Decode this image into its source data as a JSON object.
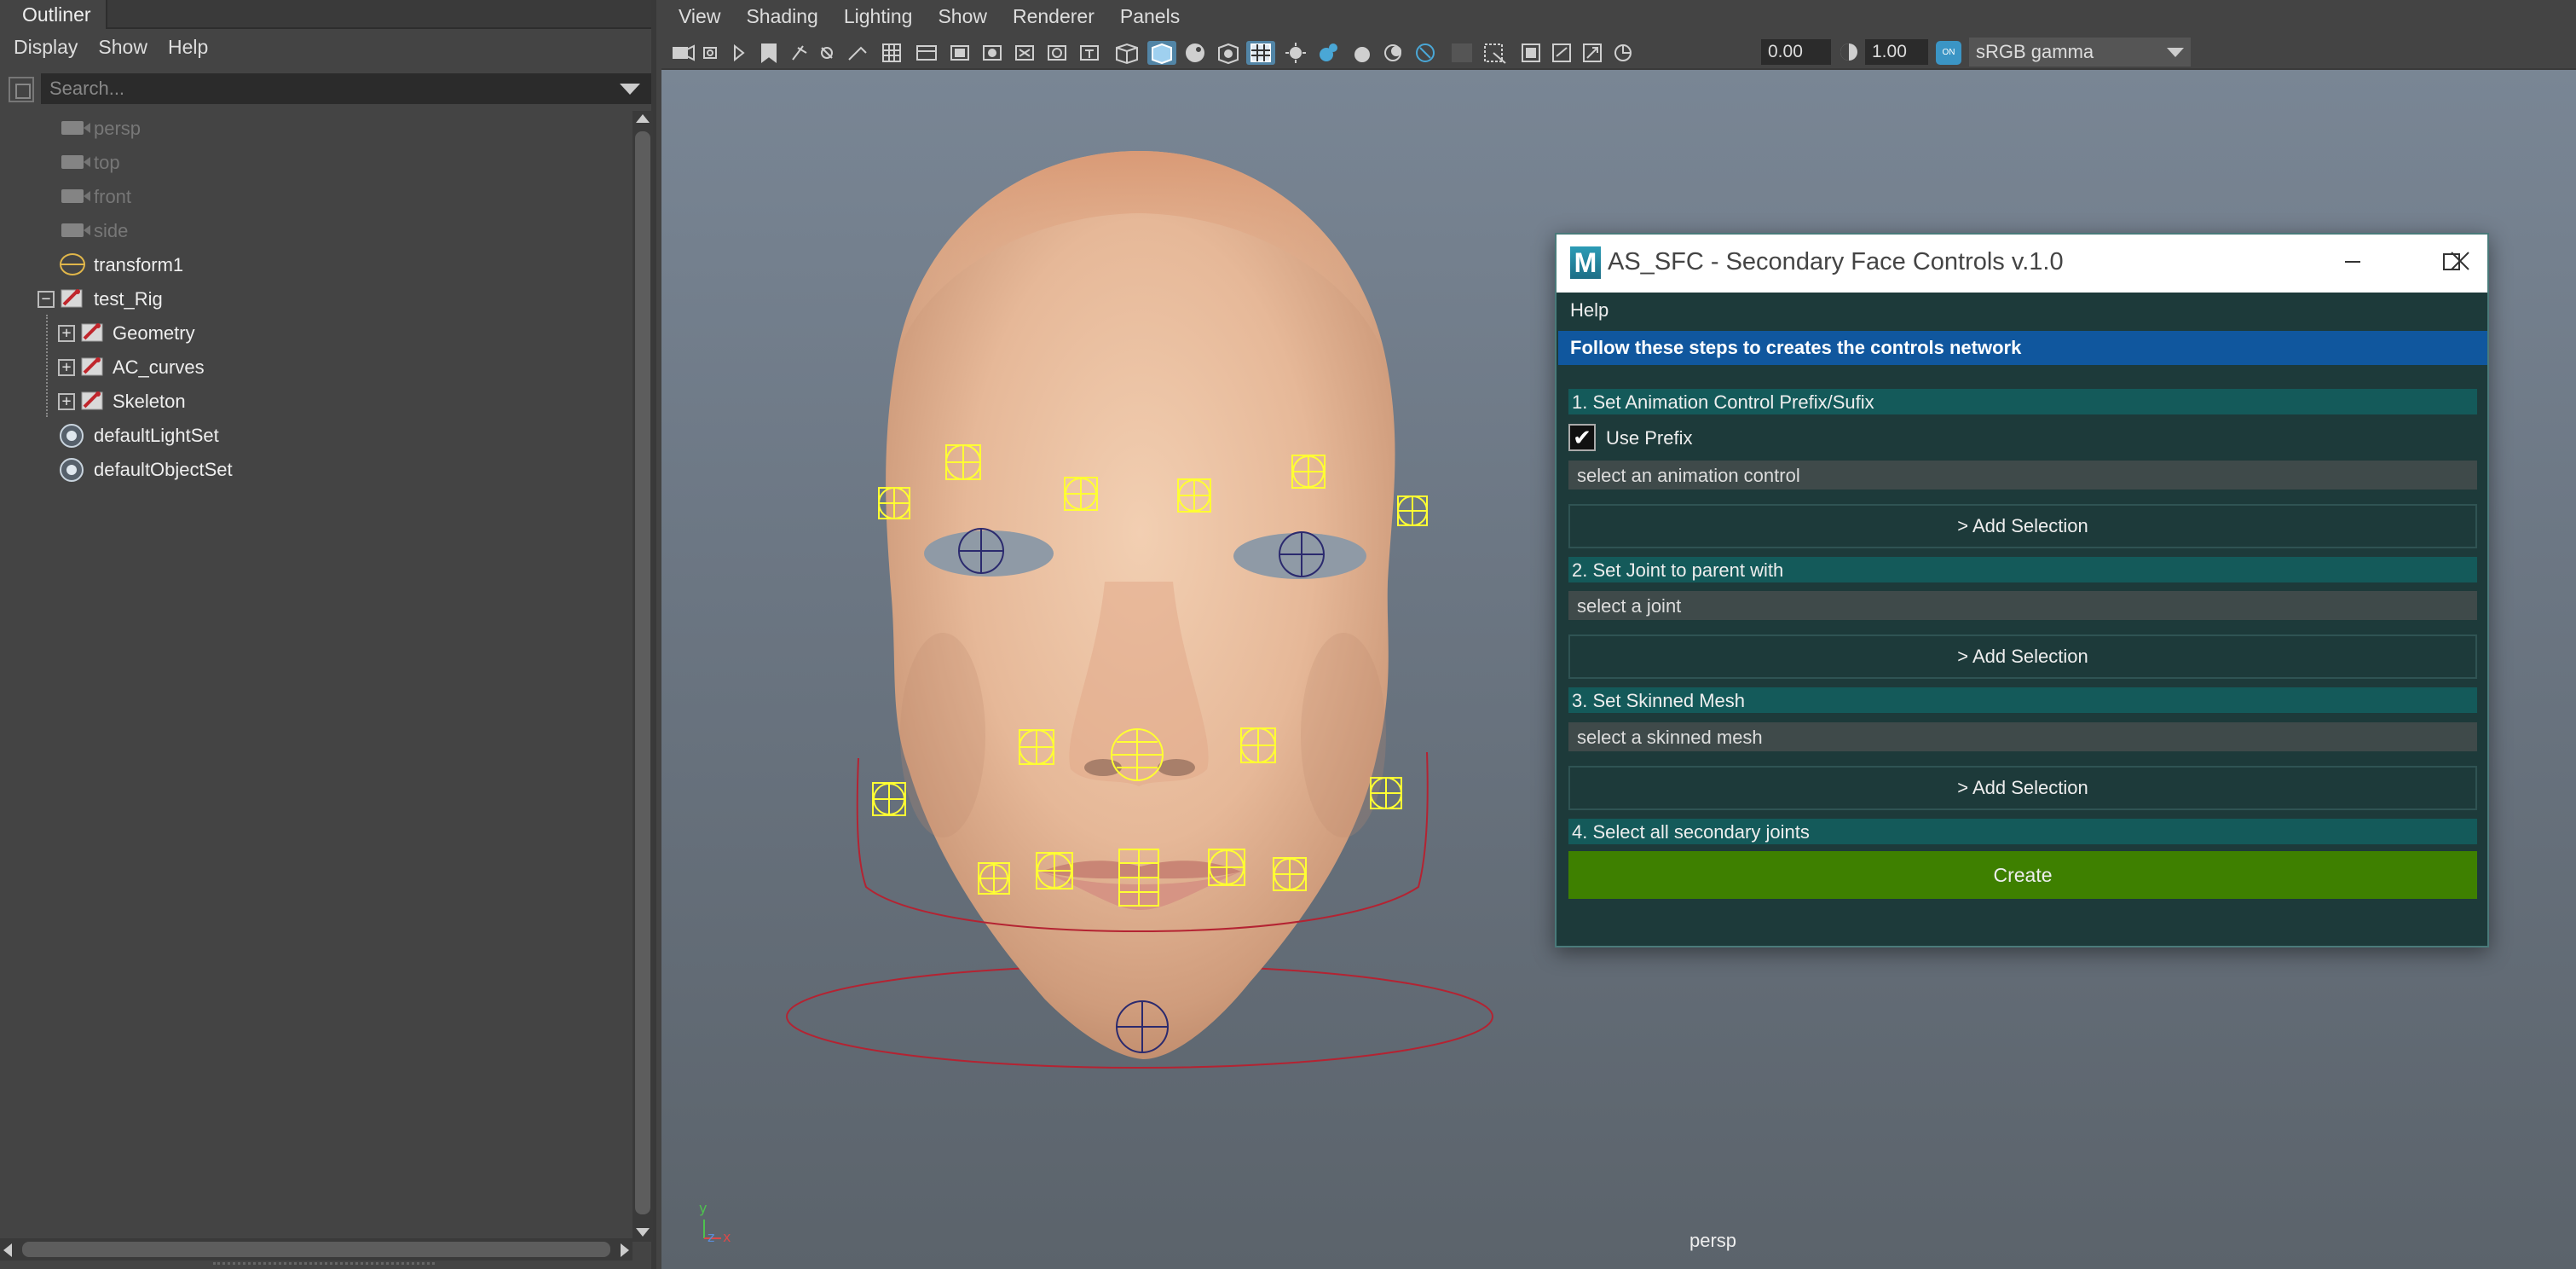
{
  "outliner": {
    "tab_title": "Outliner",
    "menu": [
      "Display",
      "Show",
      "Help"
    ],
    "search_placeholder": "Search...",
    "items": [
      {
        "label": "persp"
      },
      {
        "label": "top"
      },
      {
        "label": "front"
      },
      {
        "label": "side"
      },
      {
        "label": "transform1"
      },
      {
        "label": "test_Rig"
      },
      {
        "label": "Geometry"
      },
      {
        "label": "AC_curves"
      },
      {
        "label": "Skeleton"
      },
      {
        "label": "defaultLightSet"
      },
      {
        "label": "defaultObjectSet"
      }
    ]
  },
  "viewport": {
    "menu": [
      "View",
      "Shading",
      "Lighting",
      "Show",
      "Renderer",
      "Panels"
    ],
    "exposure_value": "0.00",
    "gamma_value": "1.00",
    "color_space": "sRGB gamma",
    "camera_label": "persp",
    "axis": {
      "y": "y",
      "z": "z",
      "x": "x"
    }
  },
  "dialog": {
    "title": "AS_SFC - Secondary Face Controls v.1.0",
    "menu_help": "Help",
    "banner": "Follow these steps to creates the controls network",
    "step1": "1. Set Animation Control Prefix/Sufix",
    "use_prefix_label": "Use Prefix",
    "use_prefix_checked": true,
    "anim_control_field": "select an animation control",
    "add_selection_1": "> Add Selection",
    "step2": "2. Set Joint to parent with",
    "joint_field": "select a joint",
    "add_selection_2": "> Add Selection",
    "step3": "3. Set Skinned Mesh",
    "mesh_field": "select a skinned mesh",
    "add_selection_3": "> Add Selection",
    "step4": "4. Select all secondary joints",
    "create_button": "Create"
  },
  "colors": {
    "dialog_bg": "#1d3a3a",
    "banner": "#10579e",
    "step_header": "#145a5a",
    "create": "#3e8000",
    "control_curves": "#ffff33",
    "rig_curves": "#b42332"
  }
}
